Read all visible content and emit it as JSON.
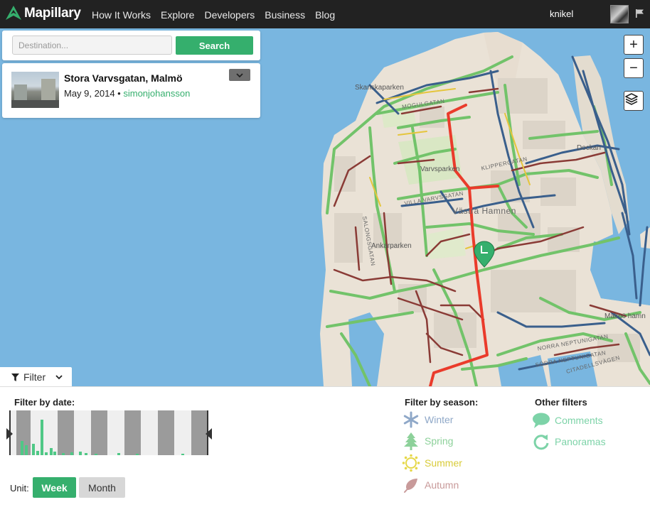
{
  "nav": {
    "brand": "Mapillary",
    "items": [
      "How It Works",
      "Explore",
      "Developers",
      "Business",
      "Blog"
    ],
    "username": "knikel"
  },
  "search": {
    "placeholder": "Destination...",
    "button_label": "Search"
  },
  "image_card": {
    "title": "Stora Varvsgatan, Malmö",
    "date": "May 9, 2014",
    "separator": "•",
    "user": "simonjohansson"
  },
  "map": {
    "labels": {
      "skanska": "Skanskaparken",
      "varvsparken": "Varvsparken",
      "vastra": "Västra Hamnen",
      "ankarparken": "Ankarparken",
      "dockan": "Dockan",
      "malmo_hamn": "Malmö hamn",
      "klipper": "KLIPPERGATAN",
      "villa": "VILLA VARVSGATAN",
      "salong": "SALONGSGATAN",
      "norra": "NORRA NEPTUNIGATAN",
      "sodra": "SÖDRA NEPTUNIGATAN",
      "citadells": "CITADELLSVÄGEN",
      "mogul": "MOGULGATAN"
    },
    "zoom_in": "+",
    "zoom_out": "−",
    "colors": {
      "water": "#79b6e0",
      "land": "#eae2d6",
      "route_green": "#72c36a",
      "route_red": "#ea3b2b",
      "route_blue": "#3a5f8c",
      "route_brown": "#8a3b36",
      "route_yellow": "#e5c53c",
      "accent": "#35af6d"
    }
  },
  "filter": {
    "tab_label": "Filter",
    "date_title": "Filter by date:",
    "season_title": "Filter by season:",
    "other_title": "Other filters",
    "seasons": [
      {
        "label": "Winter",
        "icon": "snowflake-icon",
        "color": "#8fa8c8"
      },
      {
        "label": "Spring",
        "icon": "tree-icon",
        "color": "#8dd19a"
      },
      {
        "label": "Summer",
        "icon": "sun-icon",
        "color": "#e6d84a"
      },
      {
        "label": "Autumn",
        "icon": "leaf-icon",
        "color": "#c89a9a"
      }
    ],
    "others": [
      {
        "label": "Comments",
        "icon": "comment-icon",
        "color": "#7dd3a8"
      },
      {
        "label": "Panoramas",
        "icon": "rotate-icon",
        "color": "#7dd3a8"
      }
    ],
    "unit_label": "Unit:",
    "unit_week": "Week",
    "unit_month": "Month"
  }
}
